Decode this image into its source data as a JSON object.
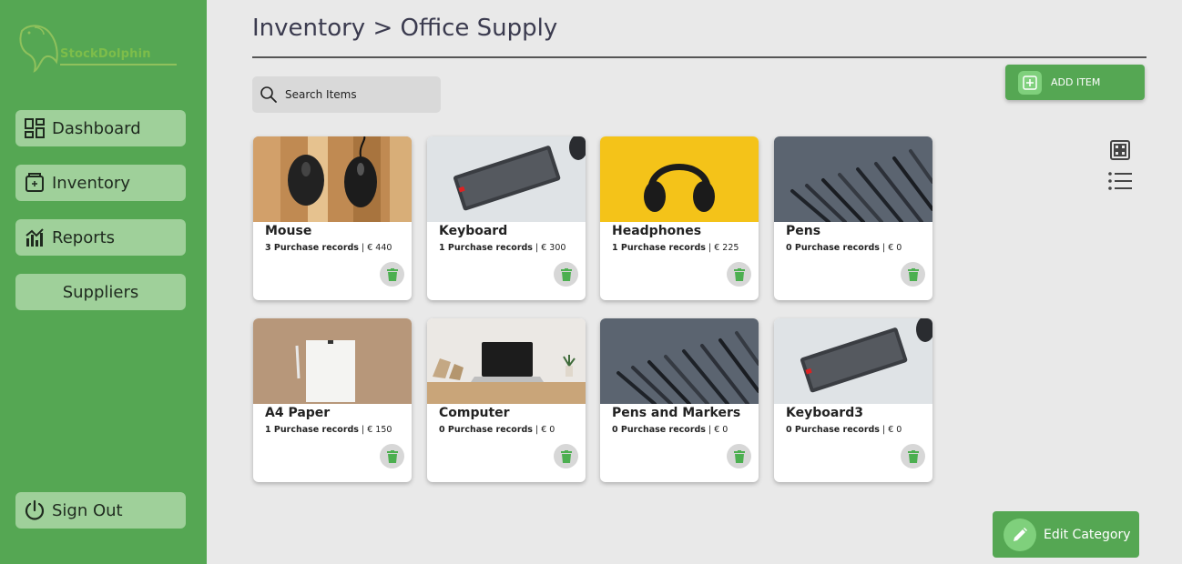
{
  "sidebar": {
    "logo_text": "StockDolphin",
    "nav": [
      {
        "label": "Dashboard",
        "icon": "dashboard-icon"
      },
      {
        "label": "Inventory",
        "icon": "inventory-icon"
      },
      {
        "label": "Reports",
        "icon": "reports-icon"
      },
      {
        "label": "Suppliers",
        "icon": ""
      }
    ],
    "signout": {
      "label": "Sign Out",
      "icon": "power-icon"
    }
  },
  "header": {
    "title": "Inventory > Office Supply"
  },
  "search": {
    "placeholder": "Search Items",
    "icon": "search-icon"
  },
  "add_item": {
    "label": "ADD ITEM",
    "icon": "plus-square-icon"
  },
  "view_toggle": {
    "grid_icon": "grid-view-icon",
    "list_icon": "list-view-icon"
  },
  "items": [
    {
      "name": "Mouse",
      "records": "3 Purchase records",
      "price": "€ 440",
      "image": "mouse-photo"
    },
    {
      "name": "Keyboard",
      "records": "1 Purchase records",
      "price": "€ 300",
      "image": "keyboard-photo"
    },
    {
      "name": "Headphones",
      "records": "1 Purchase records",
      "price": "€ 225",
      "image": "headphones-photo"
    },
    {
      "name": "Pens",
      "records": "0 Purchase records",
      "price": "€ 0",
      "image": "pens-photo"
    },
    {
      "name": "A4 Paper",
      "records": "1 Purchase records",
      "price": "€ 150",
      "image": "paper-photo"
    },
    {
      "name": "Computer",
      "records": "0 Purchase records",
      "price": "€ 0",
      "image": "laptop-photo"
    },
    {
      "name": "Pens and Markers",
      "records": "0 Purchase records",
      "price": "€ 0",
      "image": "pens-photo"
    },
    {
      "name": "Keyboard3",
      "records": "0 Purchase records",
      "price": "€ 0",
      "image": "keyboard-photo"
    }
  ],
  "edit_category": {
    "label": "Edit Category",
    "icon": "pencil-icon"
  },
  "colors": {
    "sidebar": "#55a753",
    "nav_button": "#9fd09a",
    "background": "#e9e9e9",
    "accent_light": "#7fd07c",
    "trash_icon": "#4caf50"
  }
}
